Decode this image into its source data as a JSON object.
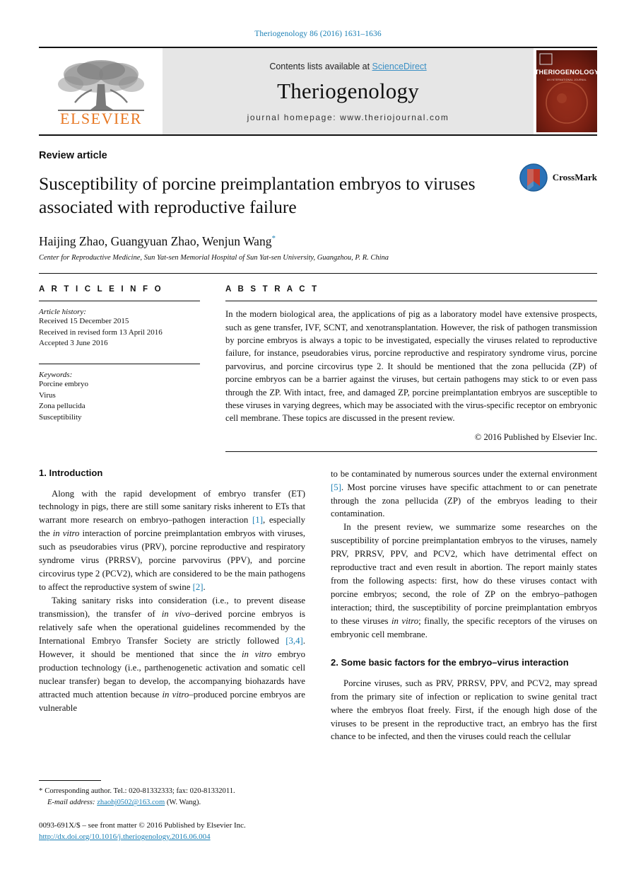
{
  "running_head": "Theriogenology 86 (2016) 1631–1636",
  "masthead": {
    "publisher_logo_name": "ELSEVIER",
    "contents_prefix": "Contents lists available at ",
    "contents_link": "ScienceDirect",
    "journal_name": "Theriogenology",
    "journal_homepage": "journal homepage: www.theriojournal.com",
    "cover_title": "THERIOGENOLOGY",
    "cover_subtitle": "AN INTERNATIONAL JOURNAL OF ANIMAL REPRODUCTION"
  },
  "title_block": {
    "article_type": "Review article",
    "title": "Susceptibility of porcine preimplantation embryos to viruses associated with reproductive failure",
    "authors": "Haijing Zhao, Guangyuan Zhao, Wenjun Wang",
    "author_marker": "*",
    "affiliation": "Center for Reproductive Medicine, Sun Yat-sen Memorial Hospital of Sun Yat-sen University, Guangzhou, P. R. China",
    "crossmark_label": "CrossMark"
  },
  "article_info": {
    "heading": "A R T I C L E   I N F O",
    "history_title": "Article history:",
    "history": [
      "Received 15 December 2015",
      "Received in revised form 13 April 2016",
      "Accepted 3 June 2016"
    ],
    "keywords_title": "Keywords:",
    "keywords": [
      "Porcine embryo",
      "Virus",
      "Zona pellucida",
      "Susceptibility"
    ]
  },
  "abstract": {
    "heading": "A B S T R A C T",
    "text": "In the modern biological area, the applications of pig as a laboratory model have extensive prospects, such as gene transfer, IVF, SCNT, and xenotransplantation. However, the risk of pathogen transmission by porcine embryos is always a topic to be investigated, especially the viruses related to reproductive failure, for instance, pseudorabies virus, porcine reproductive and respiratory syndrome virus, porcine parvovirus, and porcine circovirus type 2. It should be mentioned that the zona pellucida (ZP) of porcine embryos can be a barrier against the viruses, but certain pathogens may stick to or even pass through the ZP. With intact, free, and damaged ZP, porcine preimplantation embryos are susceptible to these viruses in varying degrees, which may be associated with the virus-specific receptor on embryonic cell membrane. These topics are discussed in the present review.",
    "copyright": "© 2016 Published by Elsevier Inc."
  },
  "sections": {
    "intro_heading": "1. Introduction",
    "basic_factors_heading": "2. Some basic factors for the embryo–virus interaction"
  },
  "left_column": {
    "p1_a": "Along with the rapid development of embryo transfer (ET) technology in pigs, there are still some sanitary risks inherent to ETs that warrant more research on embryo–pathogen interaction ",
    "p1_ref1": "[1]",
    "p1_b": ", especially the ",
    "p1_it1": "in vitro",
    "p1_c": " interaction of porcine preimplantation embryos with viruses, such as pseudorabies virus (PRV), porcine reproductive and respiratory syndrome virus (PRRSV), porcine parvovirus (PPV), and porcine circovirus type 2 (PCV2), which are considered to be the main pathogens to affect the reproductive system of swine ",
    "p1_ref2": "[2]",
    "p1_d": ".",
    "p2_a": "Taking sanitary risks into consideration (i.e., to prevent disease transmission), the transfer of ",
    "p2_it1": "in vivo",
    "p2_b": "–derived porcine embryos is relatively safe when the operational guidelines recommended by the International Embryo Transfer Society are strictly followed ",
    "p2_ref1": "[3,4]",
    "p2_c": ". However, it should be mentioned that since the ",
    "p2_it2": "in vitro",
    "p2_d": " embryo production technology (i.e., parthenogenetic activation and somatic cell nuclear transfer) began to develop, the accompanying biohazards have attracted much attention because ",
    "p2_it3": "in vitro",
    "p2_e": "–produced porcine embryos are vulnerable"
  },
  "right_column": {
    "p1_a": "to be contaminated by numerous sources under the external environment ",
    "p1_ref1": "[5]",
    "p1_b": ". Most porcine viruses have specific attachment to or can penetrate through the zona pellucida (ZP) of the embryos leading to their contamination.",
    "p2_a": "In the present review, we summarize some researches on the susceptibility of porcine preimplantation embryos to the viruses, namely PRV, PRRSV, PPV, and PCV2, which have detrimental effect on reproductive tract and even result in abortion. The report mainly states from the following aspects: first, how do these viruses contact with porcine embryos; second, the role of ZP on the embryo–pathogen interaction; third, the susceptibility of porcine preimplantation embryos to these viruses ",
    "p2_it1": "in vitro",
    "p2_b": "; finally, the specific receptors of the viruses on embryonic cell membrane.",
    "p3_a": "Porcine viruses, such as PRV, PRRSV, PPV, and PCV2, may spread from the primary site of infection or replication to swine genital tract where the embryos float freely. First, if the enough high dose of the viruses to be present in the reproductive tract, an embryo has the first chance to be infected, and then the viruses could reach the cellular"
  },
  "footer": {
    "corresponding_star": "*",
    "corresponding_text": "Corresponding author. Tel.: 020-81332333; fax: 020-81332011.",
    "email_label": "E-mail address:",
    "email": "zhaohj0502@163.com",
    "email_suffix": "(W. Wang).",
    "imprint_line": "0093-691X/$ – see front matter © 2016 Published by Elsevier Inc.",
    "doi": "http://dx.doi.org/10.1016/j.theriogenology.2016.06.004"
  },
  "colors": {
    "link_blue": "#1a7fb5",
    "sciencedirect_blue": "#3a8fc4",
    "elsevier_orange": "#e87722",
    "cover_maroon": "#7a1f12",
    "crossmark_blue": "#2b73b8",
    "crossmark_red": "#c0392b"
  }
}
